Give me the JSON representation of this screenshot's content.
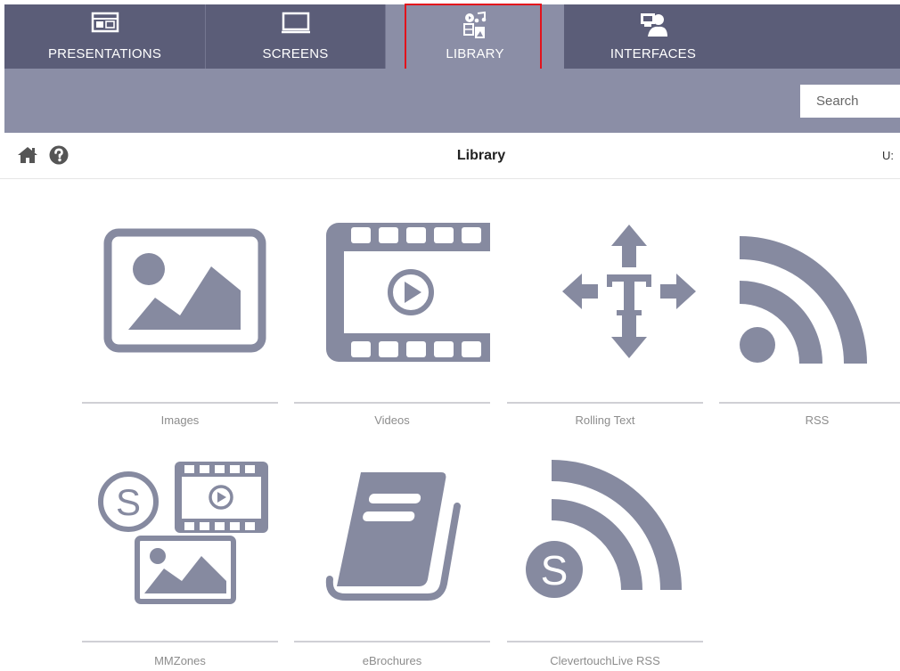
{
  "nav": {
    "tabs": [
      {
        "label": "PRESENTATIONS",
        "icon": "presentation-icon"
      },
      {
        "label": "SCREENS",
        "icon": "monitor-icon"
      },
      {
        "label": "LIBRARY",
        "icon": "media-library-icon",
        "active": true
      },
      {
        "label": "INTERFACES",
        "icon": "interface-user-icon"
      }
    ]
  },
  "search": {
    "placeholder": "Search"
  },
  "subheader": {
    "title": "Library",
    "user_truncated": "U:"
  },
  "library": {
    "items": [
      {
        "label": "Images",
        "icon": "image-icon"
      },
      {
        "label": "Videos",
        "icon": "video-icon"
      },
      {
        "label": "Rolling Text",
        "icon": "rolling-text-icon"
      },
      {
        "label": "RSS",
        "icon": "rss-icon"
      },
      {
        "label": "MMZones",
        "icon": "mmzones-icon"
      },
      {
        "label": "eBrochures",
        "icon": "ebrochure-icon"
      },
      {
        "label": "ClevertouchLive RSS",
        "icon": "clevertouch-rss-icon"
      }
    ]
  },
  "colors": {
    "nav": "#5b5d78",
    "active_tab": "#8b8ea6",
    "icon": "#868aa0",
    "highlight": "#e2131c"
  }
}
